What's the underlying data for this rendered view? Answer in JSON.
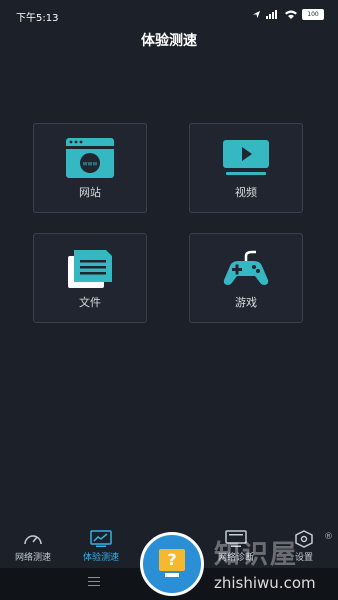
{
  "status": {
    "time": "下午5:13",
    "battery": "100",
    "icons": [
      "location-icon",
      "signal-icon",
      "wifi-icon",
      "battery-icon"
    ]
  },
  "header": {
    "title": "体验测速"
  },
  "cards": [
    {
      "label": "网站",
      "icon": "website-icon"
    },
    {
      "label": "视频",
      "icon": "video-play-icon"
    },
    {
      "label": "文件",
      "icon": "file-icon"
    },
    {
      "label": "游戏",
      "icon": "gamepad-icon"
    }
  ],
  "nav": [
    {
      "label": "网络测速",
      "icon": "speedometer-icon",
      "active": false
    },
    {
      "label": "体验测速",
      "icon": "chart-monitor-icon",
      "active": true
    },
    {
      "label": "",
      "icon": "",
      "active": false
    },
    {
      "label": "网络诊断",
      "icon": "monitor-icon",
      "active": false
    },
    {
      "label": "设置",
      "icon": "settings-hexagon-icon",
      "active": false
    }
  ],
  "watermark": {
    "name": "知识屋",
    "url": "zhishiwu.com",
    "mark": "®",
    "glyph": "?"
  },
  "colors": {
    "background": "#1c2029",
    "card": "#20252f",
    "card_border": "#3a404b",
    "accent": "#3ab0e8",
    "icon_teal": "#35b8c2"
  }
}
